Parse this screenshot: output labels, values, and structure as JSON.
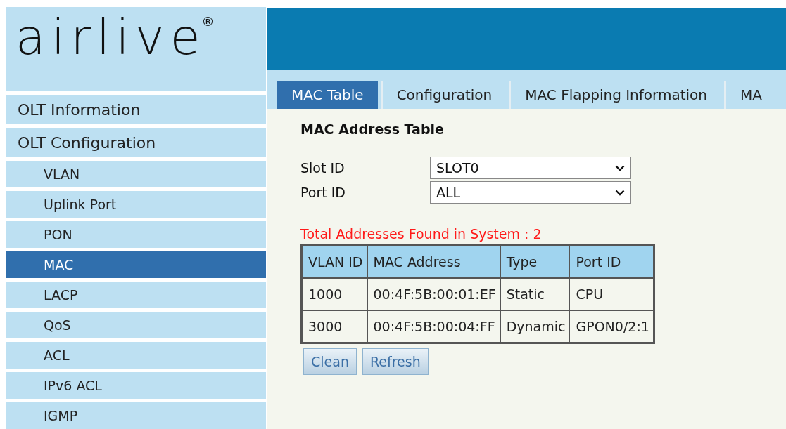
{
  "logo": {
    "text": "airlive",
    "mark": "®"
  },
  "sidebar": {
    "items": [
      {
        "label": "OLT Information",
        "selected": false
      },
      {
        "label": "OLT Configuration",
        "selected": false,
        "children": [
          {
            "label": "VLAN",
            "selected": false
          },
          {
            "label": "Uplink Port",
            "selected": false
          },
          {
            "label": "PON",
            "selected": false
          },
          {
            "label": "MAC",
            "selected": true
          },
          {
            "label": "LACP",
            "selected": false
          },
          {
            "label": "QoS",
            "selected": false
          },
          {
            "label": "ACL",
            "selected": false
          },
          {
            "label": "IPv6 ACL",
            "selected": false
          },
          {
            "label": "IGMP",
            "selected": false
          }
        ]
      }
    ]
  },
  "tabs": [
    {
      "label": "MAC Table",
      "selected": true
    },
    {
      "label": "Configuration",
      "selected": false
    },
    {
      "label": "MAC Flapping Information",
      "selected": false
    },
    {
      "label": "MA",
      "selected": false
    }
  ],
  "section_title": "MAC Address Table",
  "fields": [
    {
      "label": "Slot ID",
      "value": "SLOT0"
    },
    {
      "label": "Port ID",
      "value": "ALL"
    }
  ],
  "summary": "Total Addresses Found in System : 2",
  "table": {
    "columns": [
      "VLAN ID",
      "MAC Address",
      "Type",
      "Port ID"
    ],
    "rows": [
      [
        "1000",
        "00:4F:5B:00:01:EF",
        "Static",
        "CPU"
      ],
      [
        "3000",
        "00:4F:5B:00:04:FF",
        "Dynamic",
        "GPON0/2:1"
      ]
    ]
  },
  "buttons": [
    "Clean",
    "Refresh"
  ]
}
